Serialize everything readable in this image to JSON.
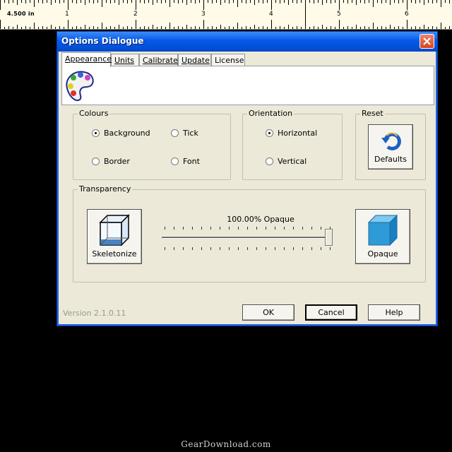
{
  "ruler": {
    "readout": "4.500 in",
    "numbers": [
      "1",
      "2",
      "3",
      "4",
      "5",
      "6"
    ]
  },
  "dialog": {
    "title": "Options Dialogue",
    "tabs": [
      {
        "label": "Appearance",
        "active": true
      },
      {
        "label": "Units",
        "active": false
      },
      {
        "label": "Calibrate",
        "active": false
      },
      {
        "label": "Update",
        "active": false
      },
      {
        "label": "License",
        "active": false
      }
    ],
    "colours": {
      "label": "Colours",
      "options": [
        "Background",
        "Tick",
        "Border",
        "Font"
      ],
      "selected": "Background"
    },
    "orientation": {
      "label": "Orientation",
      "options": [
        "Horizontal",
        "Vertical"
      ],
      "selected": "Horizontal"
    },
    "reset": {
      "label": "Reset",
      "button_label": "Defaults"
    },
    "transparency": {
      "label": "Transparency",
      "value_text": "100.00% Opaque",
      "level": 1.0,
      "skeletonize_label": "Skeletonize",
      "opaque_label": "Opaque"
    },
    "footer": {
      "version": "Version 2.1.0.11",
      "ok_label": "OK",
      "cancel_label": "Cancel",
      "help_label": "Help"
    }
  },
  "watermark": "GearDownload.com",
  "colors": {
    "titlebar": "#0658e6",
    "dialog_bg": "#ece9d8",
    "close_button": "#d5451f"
  }
}
